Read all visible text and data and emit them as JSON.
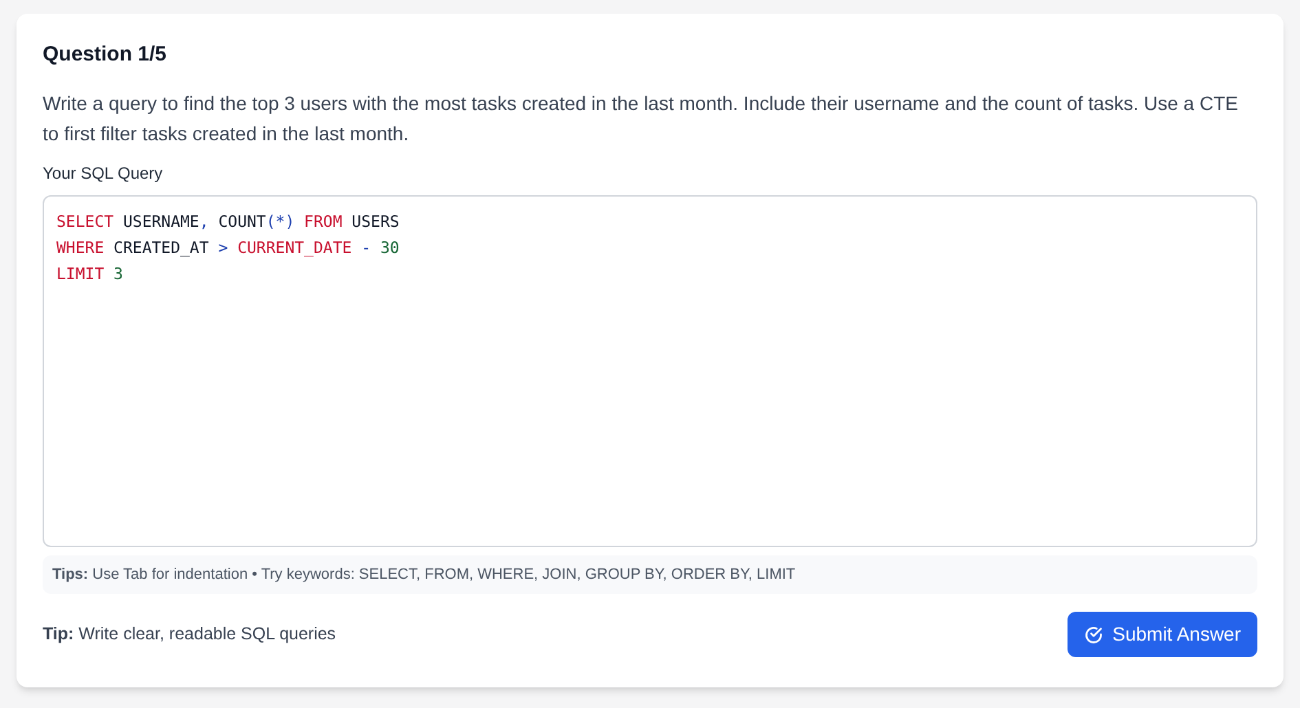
{
  "question": {
    "title": "Question 1/5",
    "prompt": "Write a query to find the top 3 users with the most tasks created in the last month. Include their username and the count of tasks. Use a CTE to first filter tasks created in the last month."
  },
  "editor": {
    "label": "Your SQL Query",
    "lines": [
      [
        {
          "kind": "keyword",
          "text": "SELECT"
        },
        {
          "kind": "plain",
          "text": " USERNAME"
        },
        {
          "kind": "punct",
          "text": ","
        },
        {
          "kind": "plain",
          "text": " COUNT"
        },
        {
          "kind": "punct",
          "text": "(*)"
        },
        {
          "kind": "keyword",
          "text": " FROM"
        },
        {
          "kind": "plain",
          "text": " USERS"
        }
      ],
      [
        {
          "kind": "keyword",
          "text": "WHERE"
        },
        {
          "kind": "plain",
          "text": " CREATED_AT "
        },
        {
          "kind": "punct",
          "text": ">"
        },
        {
          "kind": "keyword",
          "text": " CURRENT_DATE"
        },
        {
          "kind": "punct",
          "text": " - "
        },
        {
          "kind": "number",
          "text": "30"
        }
      ],
      [
        {
          "kind": "keyword",
          "text": "LIMIT"
        },
        {
          "kind": "number",
          "text": " 3"
        }
      ]
    ],
    "tips": "**Tips:** Use Tab for indentation • Try keywords: SELECT, FROM, WHERE, JOIN, GROUP BY, ORDER BY, LIMIT"
  },
  "footer": {
    "tip": "**Tip:** Write clear, readable SQL queries",
    "submit": "Submit Answer"
  }
}
